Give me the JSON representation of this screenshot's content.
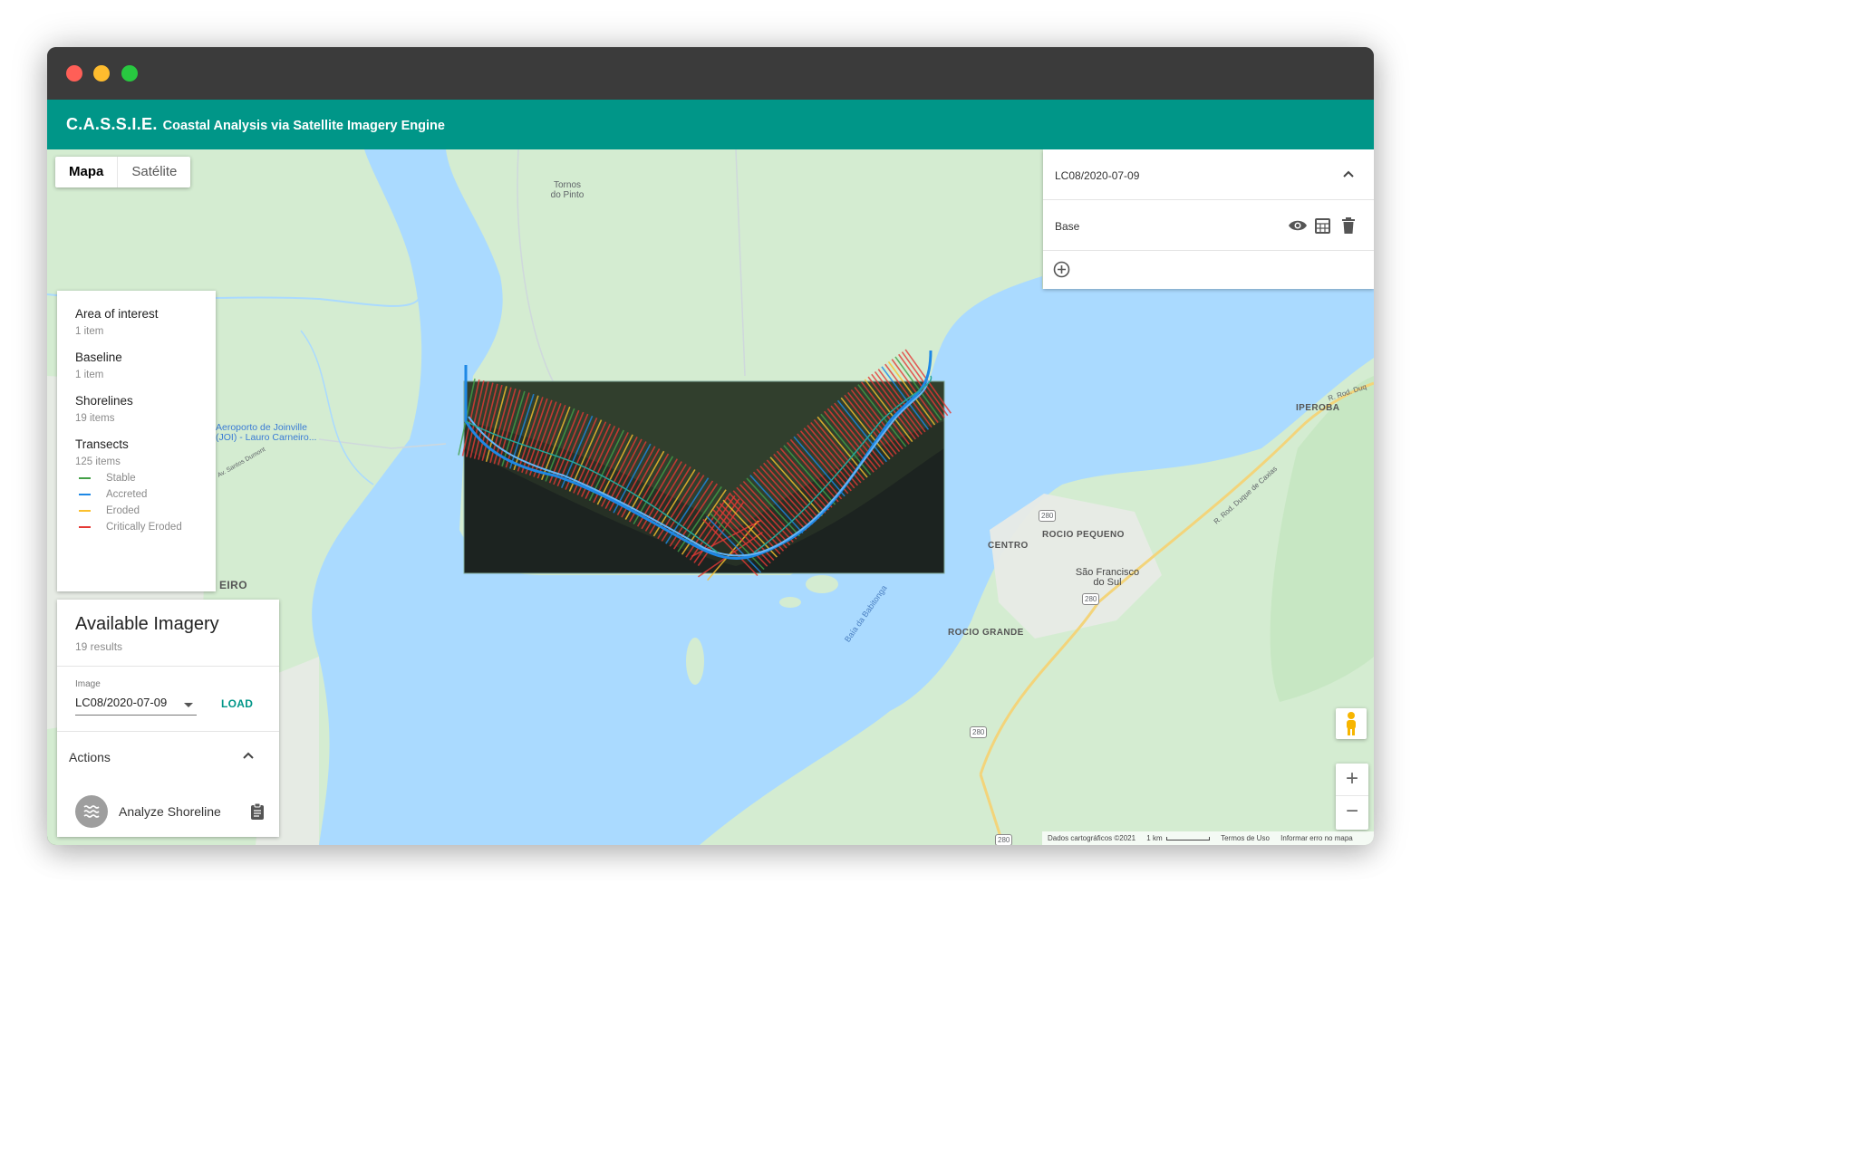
{
  "window": {
    "dot_colors": [
      "#ff5f57",
      "#febc2e",
      "#28c840"
    ]
  },
  "appbar": {
    "title": "C.A.S.S.I.E.",
    "subtitle": "Coastal Analysis via Satellite Imagery Engine",
    "color": "#009688"
  },
  "maptype": {
    "map": "Mapa",
    "satellite": "Satélite"
  },
  "layers": [
    {
      "name": "Area of interest",
      "count": "1 item"
    },
    {
      "name": "Baseline",
      "count": "1 item"
    },
    {
      "name": "Shorelines",
      "count": "19 items"
    },
    {
      "name": "Transects",
      "count": "125 items"
    }
  ],
  "legend": [
    {
      "label": "Stable",
      "color": "#43a047"
    },
    {
      "label": "Accreted",
      "color": "#1e88e5"
    },
    {
      "label": "Eroded",
      "color": "#fbc02d"
    },
    {
      "label": "Critically Eroded",
      "color": "#e53935"
    }
  ],
  "imagery": {
    "title": "Available Imagery",
    "results": "19 results",
    "image_label": "Image",
    "image_value": "LC08/2020-07-09",
    "load": "LOAD",
    "actions_title": "Actions",
    "analyze": "Analyze Shoreline"
  },
  "right_panel": {
    "header": "LC08/2020-07-09",
    "layer": "Base"
  },
  "map_labels": {
    "tornos": "Tornos\ndo Pinto",
    "aeroporto": "Aeroporto de Joinville\n(JOI) - Lauro Carneiro...",
    "santos": "Av. Santos Dumont",
    "iperoba": "IPEROBA",
    "rod_duq": "R. Rod. Duq",
    "rod_duque": "R. Rod. Duque de Caxias",
    "centro": "CENTRO",
    "rocio_pequeno": "ROCIO PEQUENO",
    "sao_francisco": "São Francisco\ndo Sul",
    "rocio_grande": "ROCIO GRANDE",
    "babitonga": "Baía da Babitonga",
    "eiro": "EIRO",
    "r280a": "280",
    "r280b": "280",
    "r280c": "280",
    "r280d": "280"
  },
  "footer": {
    "data": "Dados cartográficos ©2021",
    "scale": "1 km",
    "terms": "Termos de Uso",
    "report": "Informar erro no mapa"
  },
  "zoom": {
    "in": "+",
    "out": "−"
  }
}
